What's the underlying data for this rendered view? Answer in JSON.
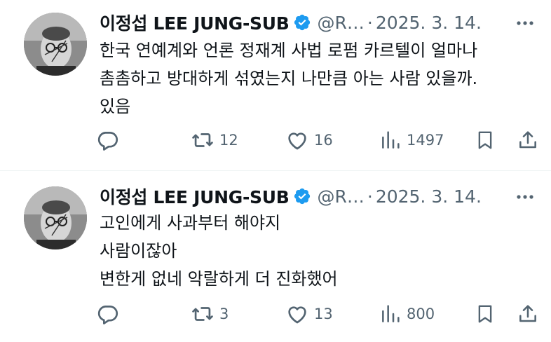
{
  "tweets": [
    {
      "author": {
        "name": "이정섭 LEE JUNG-SUB",
        "handle": "@R…",
        "verified": true
      },
      "separator": "·",
      "date": "2025. 3. 14.",
      "text_lines": [
        "한국 연예계와 언론 정재계 사법 로펌 카르텔이 얼마나",
        "촘촘하고 방대하게 섞였는지 나만큼 아는 사람 있을까.",
        "있음"
      ],
      "actions": {
        "reply_icon": "reply-icon",
        "retweet_icon": "retweet-icon",
        "retweets": "12",
        "like_icon": "heart-icon",
        "likes": "16",
        "views_icon": "views-icon",
        "views": "1497",
        "bookmark_icon": "bookmark-icon",
        "share_icon": "share-icon"
      }
    },
    {
      "author": {
        "name": "이정섭 LEE JUNG-SUB",
        "handle": "@R…",
        "verified": true
      },
      "separator": "·",
      "date": "2025. 3. 14.",
      "text_lines": [
        "고인에게 사과부터 해야지",
        "사람이잖아",
        "변한게 없네 악랄하게 더 진화했어"
      ],
      "actions": {
        "reply_icon": "reply-icon",
        "retweet_icon": "retweet-icon",
        "retweets": "3",
        "like_icon": "heart-icon",
        "likes": "13",
        "views_icon": "views-icon",
        "views": "800",
        "bookmark_icon": "bookmark-icon",
        "share_icon": "share-icon"
      }
    }
  ],
  "colors": {
    "text_primary": "#0f1419",
    "text_secondary": "#536471",
    "verified_blue": "#1d9bf0",
    "divider": "#eff3f4"
  }
}
